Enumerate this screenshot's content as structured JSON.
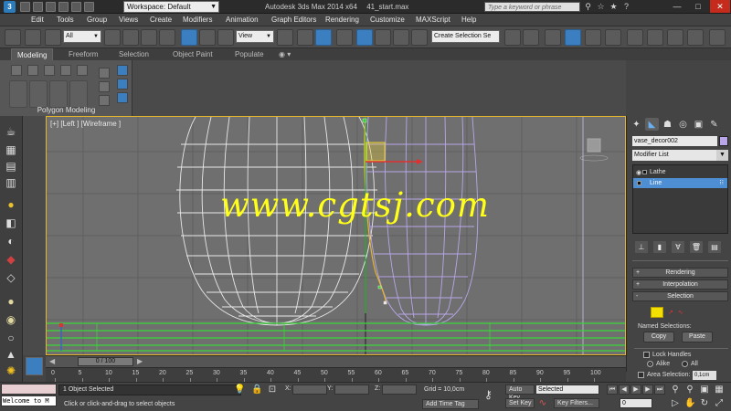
{
  "titlebar": {
    "logo": "3",
    "workspace": "Workspace: Default",
    "app_title": "Autodesk 3ds Max  2014 x64",
    "file_name": "41_start.max",
    "search_placeholder": "Type a keyword or phrase",
    "minimize": "—",
    "maximize": "□",
    "close": "✕"
  },
  "menu": {
    "edit": "Edit",
    "tools": "Tools",
    "group": "Group",
    "views": "Views",
    "create": "Create",
    "modifiers": "Modifiers",
    "animation": "Animation",
    "graph_editors": "Graph Editors",
    "rendering": "Rendering",
    "customize": "Customize",
    "maxscript": "MAXScript",
    "help": "Help"
  },
  "toolbar": {
    "filter": "All",
    "ref_coord": "View",
    "named_selection": "Create Selection Se",
    "snap_label": "3"
  },
  "ribbon": {
    "tab_modeling": "Modeling",
    "tab_freeform": "Freeform",
    "tab_selection": "Selection",
    "tab_object_paint": "Object Paint",
    "tab_populate": "Populate",
    "tab_extra": "◉ ▾",
    "panel_label": "Polygon Modeling"
  },
  "viewport": {
    "label": "[+] [Left ] [Wireframe ]",
    "watermark": "www.cgtsj.com"
  },
  "command_panel": {
    "object_name": "vase_decor002",
    "modifier_list": "Modifier List",
    "stack": [
      {
        "label": "Lathe",
        "selected": false
      },
      {
        "label": "Line",
        "selected": true
      }
    ],
    "rollout_rendering": "Rendering",
    "rollout_interpolation": "Interpolation",
    "rollout_selection": "Selection",
    "named_selections": "Named Selections:",
    "copy": "Copy",
    "paste": "Paste",
    "lock_handles": "Lock Handles",
    "alike": "Alike",
    "all": "All",
    "area_selection": "Area Selection:",
    "area_value": "0,1cm",
    "icon_colors": {
      "accent": "#4e8fd4",
      "object": "#b8a6e8"
    }
  },
  "timeline": {
    "slider": "0 / 100",
    "ticks": [
      "0",
      "5",
      "10",
      "15",
      "20",
      "25",
      "30",
      "35",
      "40",
      "45",
      "50",
      "55",
      "60",
      "65",
      "70",
      "75",
      "80",
      "85",
      "90",
      "95",
      "100"
    ]
  },
  "status": {
    "maxscript_text": "Welcome to M",
    "selected": "1 Object Selected",
    "prompt": "Click or click-and-drag to select objects",
    "x_label": "X:",
    "y_label": "Y:",
    "z_label": "Z:",
    "grid": "Grid = 10,0cm",
    "add_time_tag": "Add Time Tag",
    "auto_key": "Auto Key",
    "set_key": "Set Key",
    "selected_dropdown": "Selected",
    "key_filters": "Key Filters...",
    "frame": "0"
  }
}
